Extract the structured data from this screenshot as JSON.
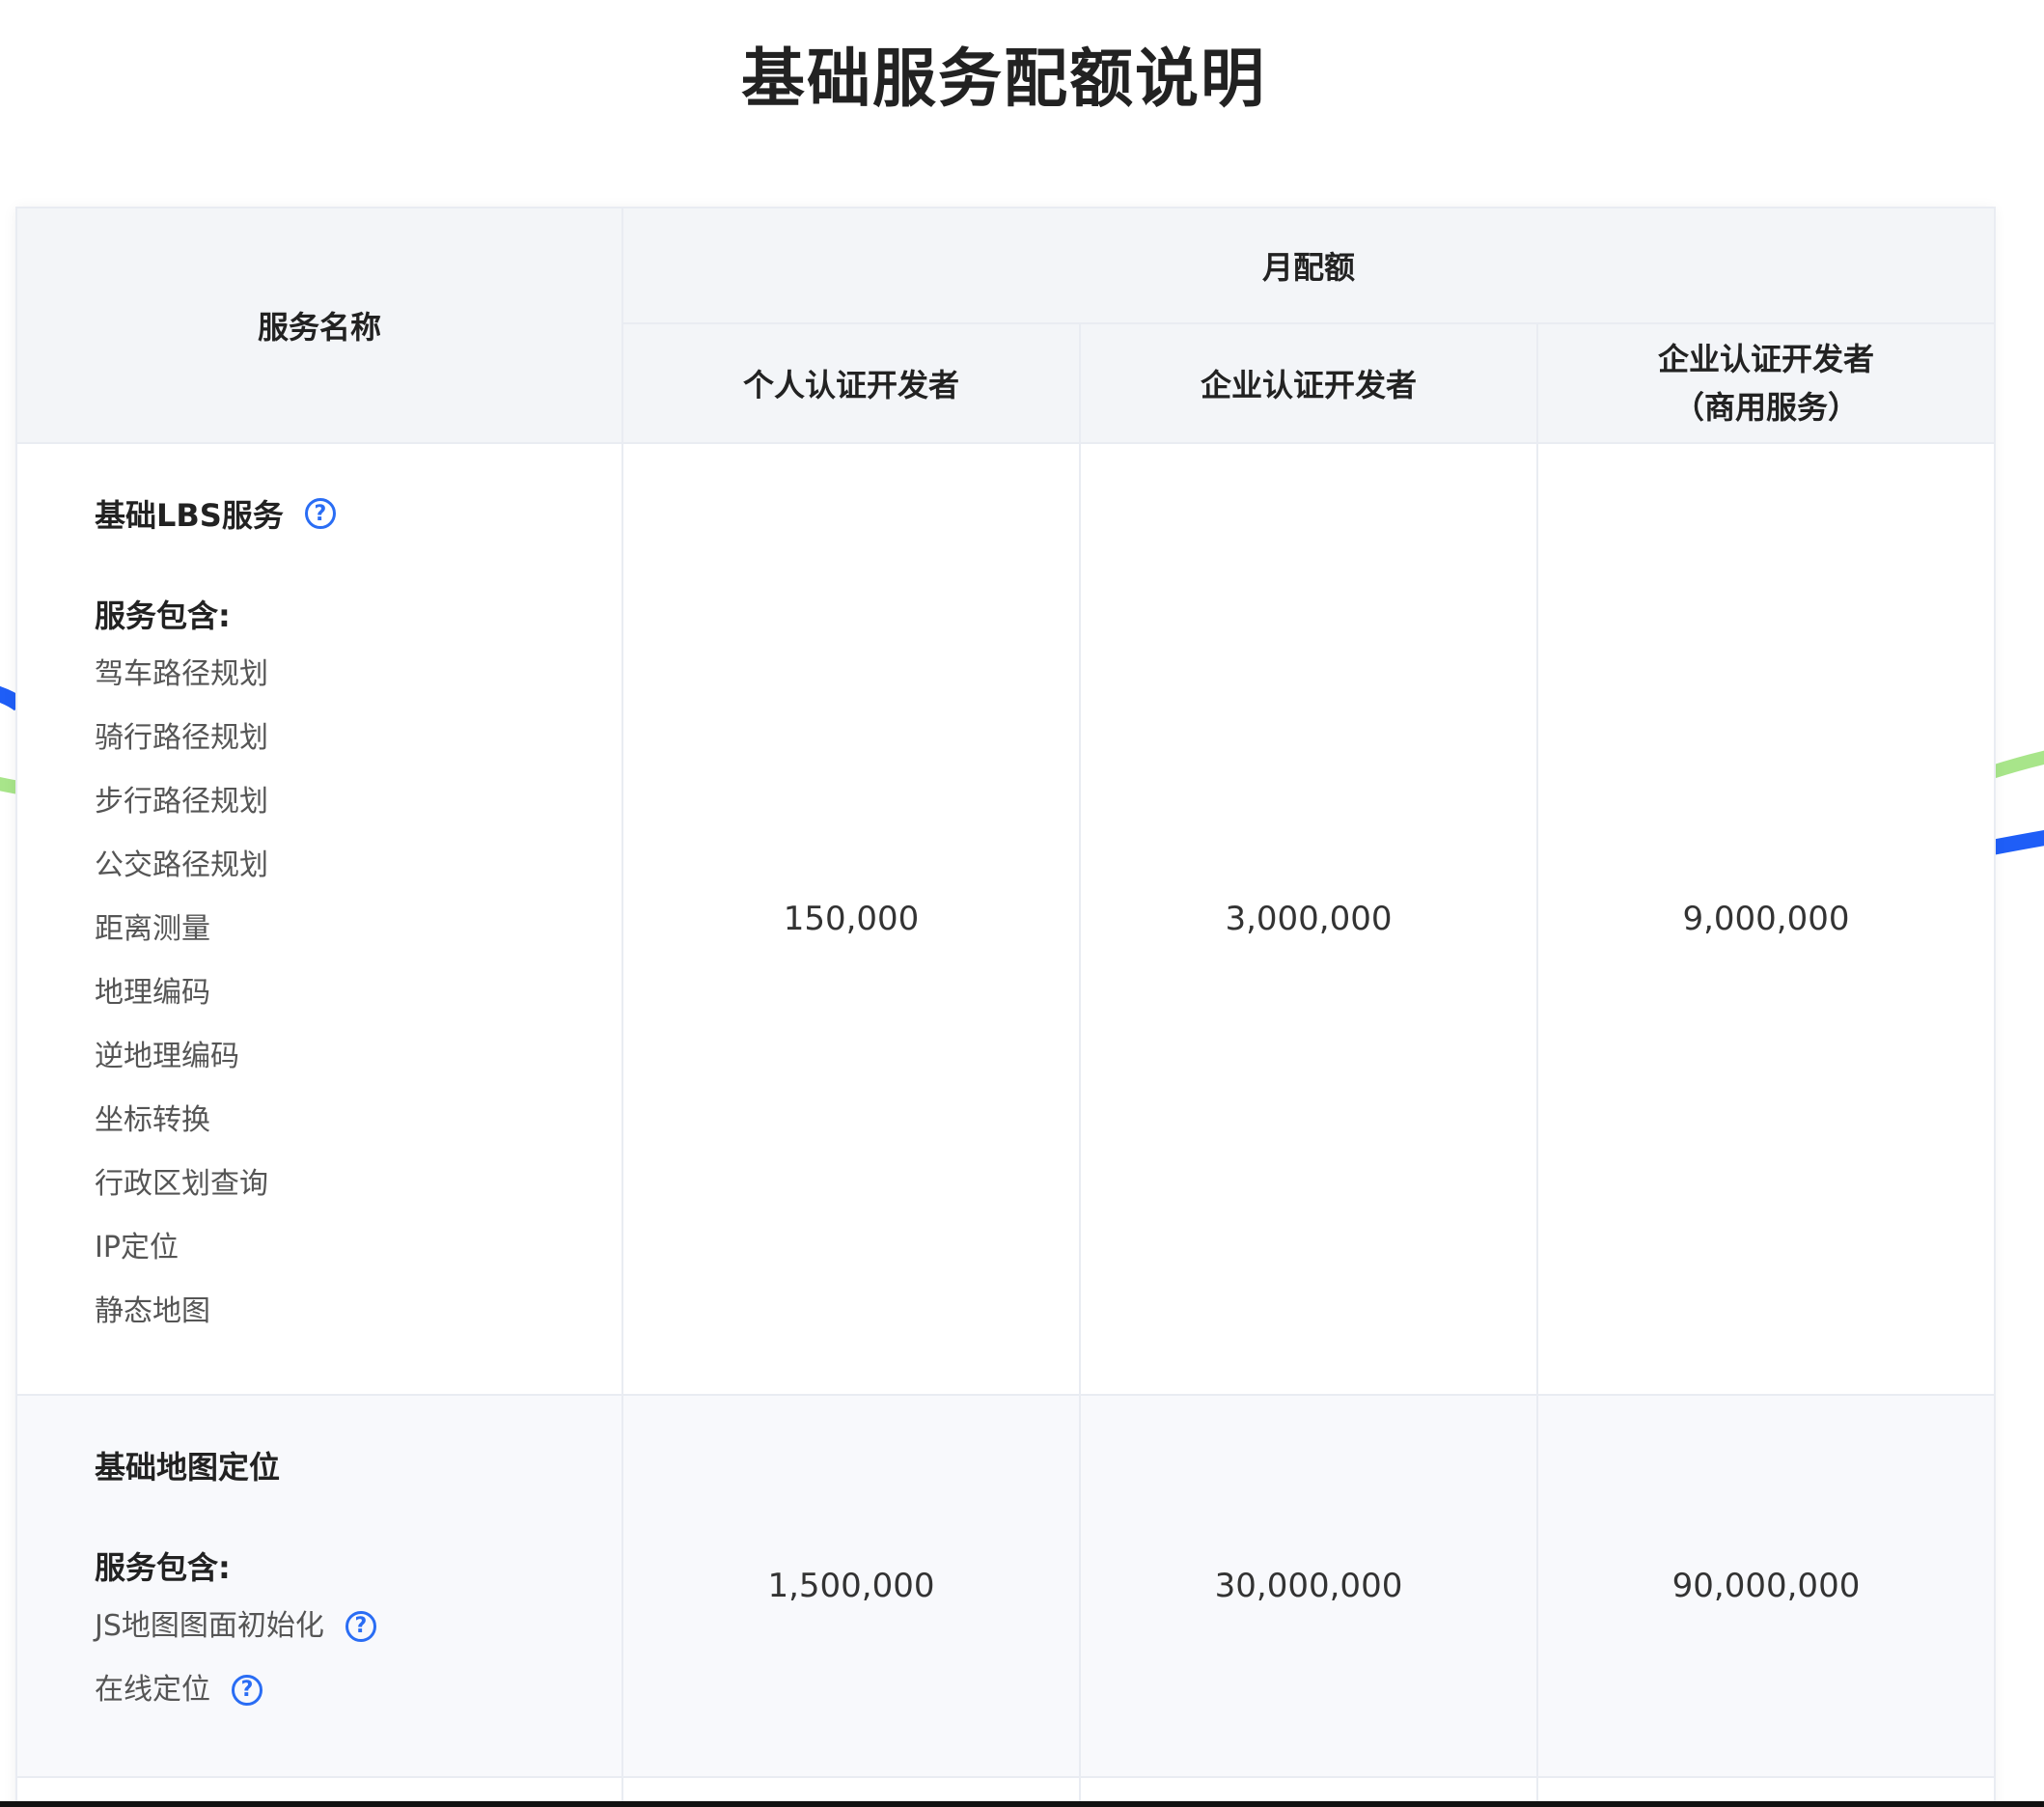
{
  "page": {
    "title": "基础服务配额说明"
  },
  "table": {
    "header": {
      "service_name": "服务名称",
      "monthly_quota": "月配额",
      "personal": "个人认证开发者",
      "enterprise": "企业认证开发者",
      "enterprise_commercial_line1": "企业认证开发者",
      "enterprise_commercial_line2": "（商用服务）"
    },
    "rows": [
      {
        "name": "基础LBS服务",
        "includes_label": "服务包含:",
        "items": [
          "驾车路径规划",
          "骑行路径规划",
          "步行路径规划",
          "公交路径规划",
          "距离测量",
          "地理编码",
          "逆地理编码",
          "坐标转换",
          "行政区划查询",
          "IP定位",
          "静态地图"
        ],
        "personal": "150,000",
        "enterprise": "3,000,000",
        "enterprise_commercial": "9,000,000"
      },
      {
        "name": "基础地图定位",
        "includes_label": "服务包含:",
        "items": [
          "JS地图图面初始化",
          "在线定位"
        ],
        "personal": "1,500,000",
        "enterprise": "30,000,000",
        "enterprise_commercial": "90,000,000"
      }
    ]
  },
  "icons": {
    "help": "?"
  },
  "colors": {
    "accent": "#2a6df4",
    "header_bg": "#f3f5f8",
    "border": "#e9ecf2",
    "deco_blue": "#1f5ef7",
    "deco_green": "#a8e58a"
  }
}
